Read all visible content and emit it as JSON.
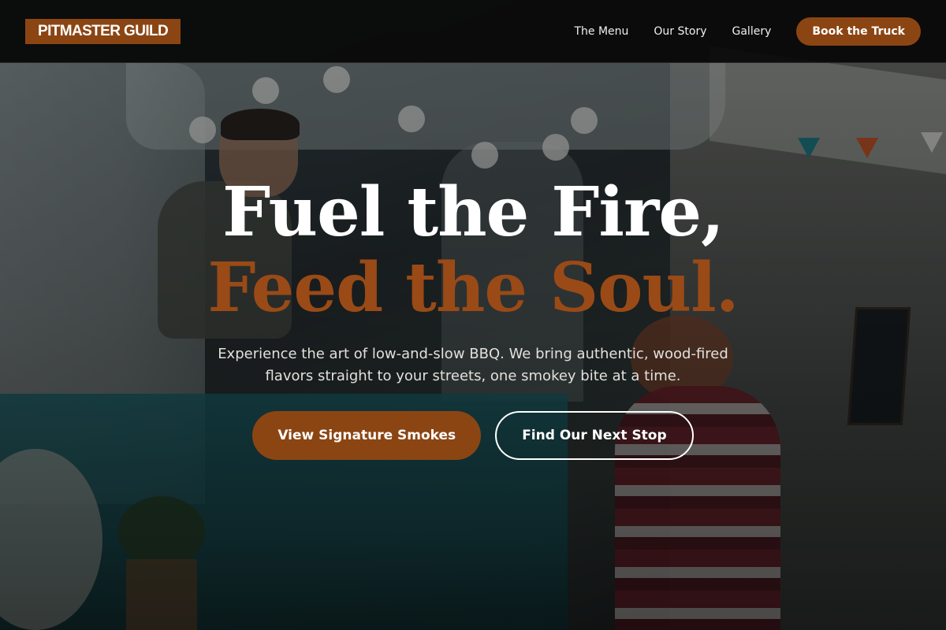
{
  "brand": {
    "name": "PITMASTER GUILD"
  },
  "nav": {
    "links": [
      "The Menu",
      "Our Story",
      "Gallery"
    ],
    "cta": "Book the Truck"
  },
  "hero": {
    "headline_line1": "Fuel the Fire,",
    "headline_line2": "Feed the Soul.",
    "subtitle": "Experience the art of low-and-slow BBQ. We bring authentic, wood-fired flavors straight to your streets, one smokey bite at a time.",
    "primary_button": "View Signature Smokes",
    "secondary_button": "Find Our Next Stop"
  },
  "colors": {
    "accent": "#8b4513",
    "headline_accent": "#9a4a16",
    "nav_background": "#0a0a0a"
  }
}
